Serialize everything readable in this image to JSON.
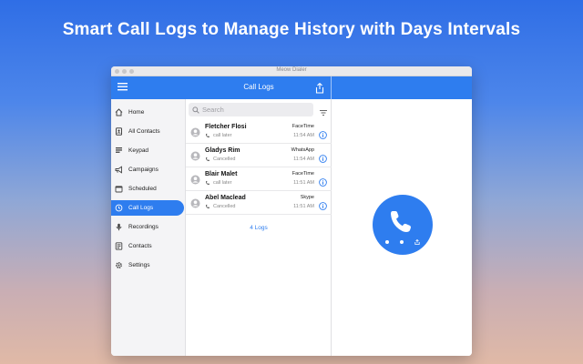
{
  "headline": "Smart Call Logs to Manage History with Days Intervals",
  "window": {
    "title": "Meow Dialer"
  },
  "appbar": {
    "title": "Call Logs"
  },
  "sidebar": {
    "items": [
      {
        "label": "Home",
        "icon": "home-icon",
        "active": false
      },
      {
        "label": "All Contacts",
        "icon": "contacts-book-icon",
        "active": false
      },
      {
        "label": "Keypad",
        "icon": "keypad-icon",
        "active": false
      },
      {
        "label": "Campaigns",
        "icon": "megaphone-icon",
        "active": false
      },
      {
        "label": "Scheduled",
        "icon": "calendar-icon",
        "active": false
      },
      {
        "label": "Call Logs",
        "icon": "history-icon",
        "active": true
      },
      {
        "label": "Recordings",
        "icon": "microphone-icon",
        "active": false
      },
      {
        "label": "Contacts",
        "icon": "contact-card-icon",
        "active": false
      },
      {
        "label": "Settings",
        "icon": "gear-icon",
        "active": false
      }
    ]
  },
  "search": {
    "placeholder": "Search"
  },
  "logs": [
    {
      "name": "Fletcher Flosi",
      "status": "call later",
      "service": "FaceTime",
      "time": "11:54 AM"
    },
    {
      "name": "Gladys Rim",
      "status": "Cancelled",
      "service": "WhatsApp",
      "time": "11:54 AM"
    },
    {
      "name": "Blair Malet",
      "status": "call later",
      "service": "FaceTime",
      "time": "11:51 AM"
    },
    {
      "name": "Abel Maclead",
      "status": "Cancelled",
      "service": "Skype",
      "time": "11:51 AM"
    }
  ],
  "log_count": "4 Logs",
  "colors": {
    "accent": "#2e7def"
  }
}
